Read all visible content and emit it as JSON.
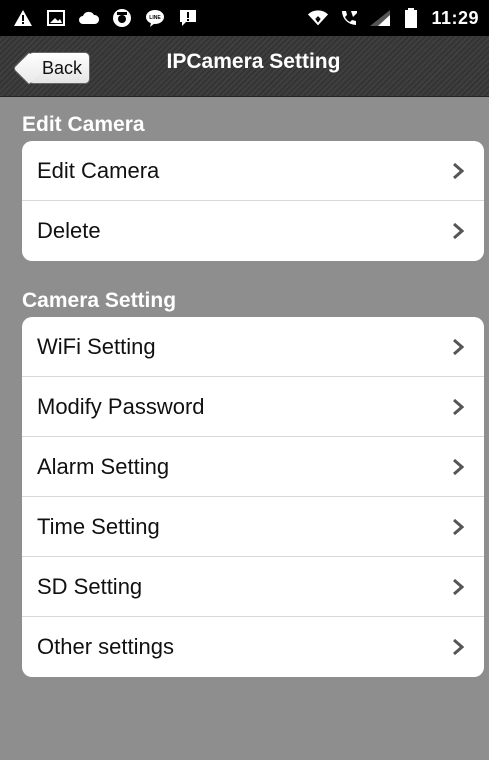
{
  "status_bar": {
    "icons_left": [
      "warning-icon",
      "image-icon",
      "cloud-icon",
      "camera-app-icon",
      "line-icon",
      "message-alert-icon"
    ],
    "icons_right": [
      "wifi-icon",
      "call-icon",
      "signal-icon",
      "battery-icon"
    ],
    "time": "11:29"
  },
  "nav": {
    "back_label": "Back",
    "title": "IPCamera Setting"
  },
  "sections": [
    {
      "header": "Edit Camera",
      "items": [
        {
          "label": "Edit Camera"
        },
        {
          "label": "Delete"
        }
      ]
    },
    {
      "header": "Camera Setting",
      "items": [
        {
          "label": "WiFi Setting"
        },
        {
          "label": "Modify Password"
        },
        {
          "label": "Alarm Setting"
        },
        {
          "label": "Time Setting"
        },
        {
          "label": "SD Setting"
        },
        {
          "label": "Other settings"
        }
      ]
    }
  ],
  "colors": {
    "background": "#8e8e8e",
    "nav_bar": "#3a3a3a",
    "status_bar": "#000000",
    "card": "#ffffff"
  }
}
